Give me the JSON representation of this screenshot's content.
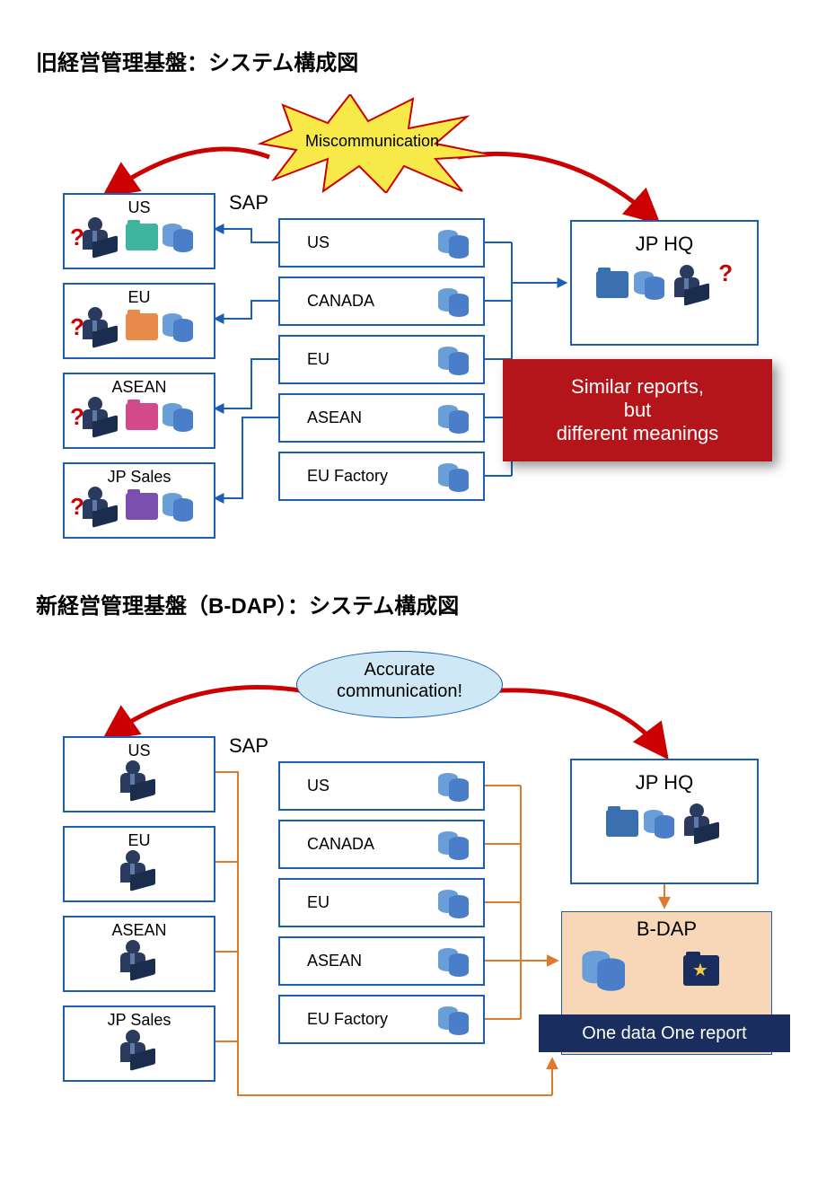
{
  "old": {
    "title": "旧経営管理基盤：システム構成図",
    "burst_label": "Miscommunication",
    "sap_label": "SAP",
    "regions": [
      "US",
      "EU",
      "ASEAN",
      "JP Sales"
    ],
    "region_folder_colors": [
      "#3fb5a0",
      "#e88b4a",
      "#d24a8a",
      "#7a4fb0"
    ],
    "sap_nodes": [
      "US",
      "CANADA",
      "EU",
      "ASEAN",
      "EU Factory"
    ],
    "hq_label": "JP HQ",
    "callout_line1": "Similar reports,",
    "callout_line2": "but",
    "callout_line3": "different meanings"
  },
  "new": {
    "title": "新経営管理基盤（B-DAP）：システム構成図",
    "oval_line1": "Accurate",
    "oval_line2": "communication!",
    "sap_label": "SAP",
    "regions": [
      "US",
      "EU",
      "ASEAN",
      "JP Sales"
    ],
    "sap_nodes": [
      "US",
      "CANADA",
      "EU",
      "ASEAN",
      "EU Factory"
    ],
    "hq_label": "JP HQ",
    "bdap_label": "B-DAP",
    "navy_label": "One data One report"
  }
}
